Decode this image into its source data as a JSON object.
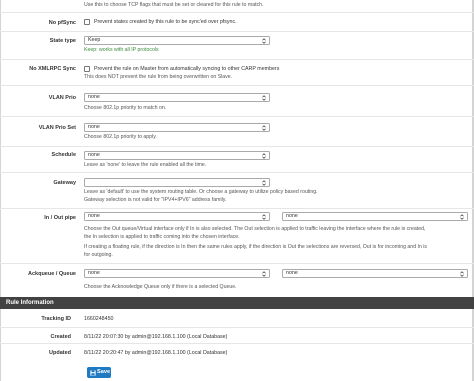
{
  "top_help": "Use this to choose TCP flags that must be set or cleared for this rule to match.",
  "no_pfsync": {
    "label": "No pfSync",
    "checkbox_text": "Prevent states created by this rule to be sync'ed over pfsync."
  },
  "state_type": {
    "label": "State type",
    "value": "Keep",
    "help": "Keep: works with all IP protocols"
  },
  "no_xmlrpc_sync": {
    "label": "No XMLRPC Sync",
    "checkbox_text": "Prevent the rule on Master from automatically syncing to other CARP members",
    "help": "This does NOT prevent the rule from being overwritten on Slave."
  },
  "vlan_prio": {
    "label": "VLAN Prio",
    "value": "none",
    "help": "Choose 802.1p priority to match on."
  },
  "vlan_prio_set": {
    "label": "VLAN Prio Set",
    "value": "none",
    "help": "Choose 802.1p priority to apply."
  },
  "schedule": {
    "label": "Schedule",
    "value": "none",
    "help": "Leave as 'none' to leave the rule enabled all the time."
  },
  "gateway": {
    "label": "Gateway",
    "value": "",
    "help1": "Leave as 'default' to use the system routing table. Or choose a gateway to utilize policy based routing.",
    "help2": "Gateway selection is not valid for \"IPV4+IPV6\" address family."
  },
  "in_out_pipe": {
    "label": "In / Out pipe",
    "in_value": "none",
    "out_value": "none",
    "help1": "Choose the Out queue/Virtual interface only if In is also selected. The Out selection is applied to traffic leaving the interface where the rule is created,",
    "help2": "the In selection is applied to traffic coming into the chosen interface.",
    "help3": "If creating a floating rule, if the direction is In then the same rules apply, if the direction is Out the selections are reversed, Out is for incoming and In is",
    "help4": "for outgoing."
  },
  "ackqueue_queue": {
    "label": "Ackqueue / Queue",
    "ack_value": "none",
    "queue_value": "none",
    "help": "Choose the Acknowledge Queue only if there is a selected Queue."
  },
  "rule_information": {
    "title": "Rule Information",
    "tracking_id_label": "Tracking ID",
    "tracking_id": "1660248450",
    "created_label": "Created",
    "created": "8/11/22 20:07:30 by admin@192.168.1.100 (Local Database)",
    "updated_label": "Updated",
    "updated": "8/11/22 20:20:47 by admin@192.168.1.100 (Local Database)"
  },
  "save_button": {
    "label": "Save",
    "color": "#1e7ac2"
  },
  "icons": {
    "select_caret": "chevron-updown-icon",
    "save": "floppy-disk-icon"
  }
}
